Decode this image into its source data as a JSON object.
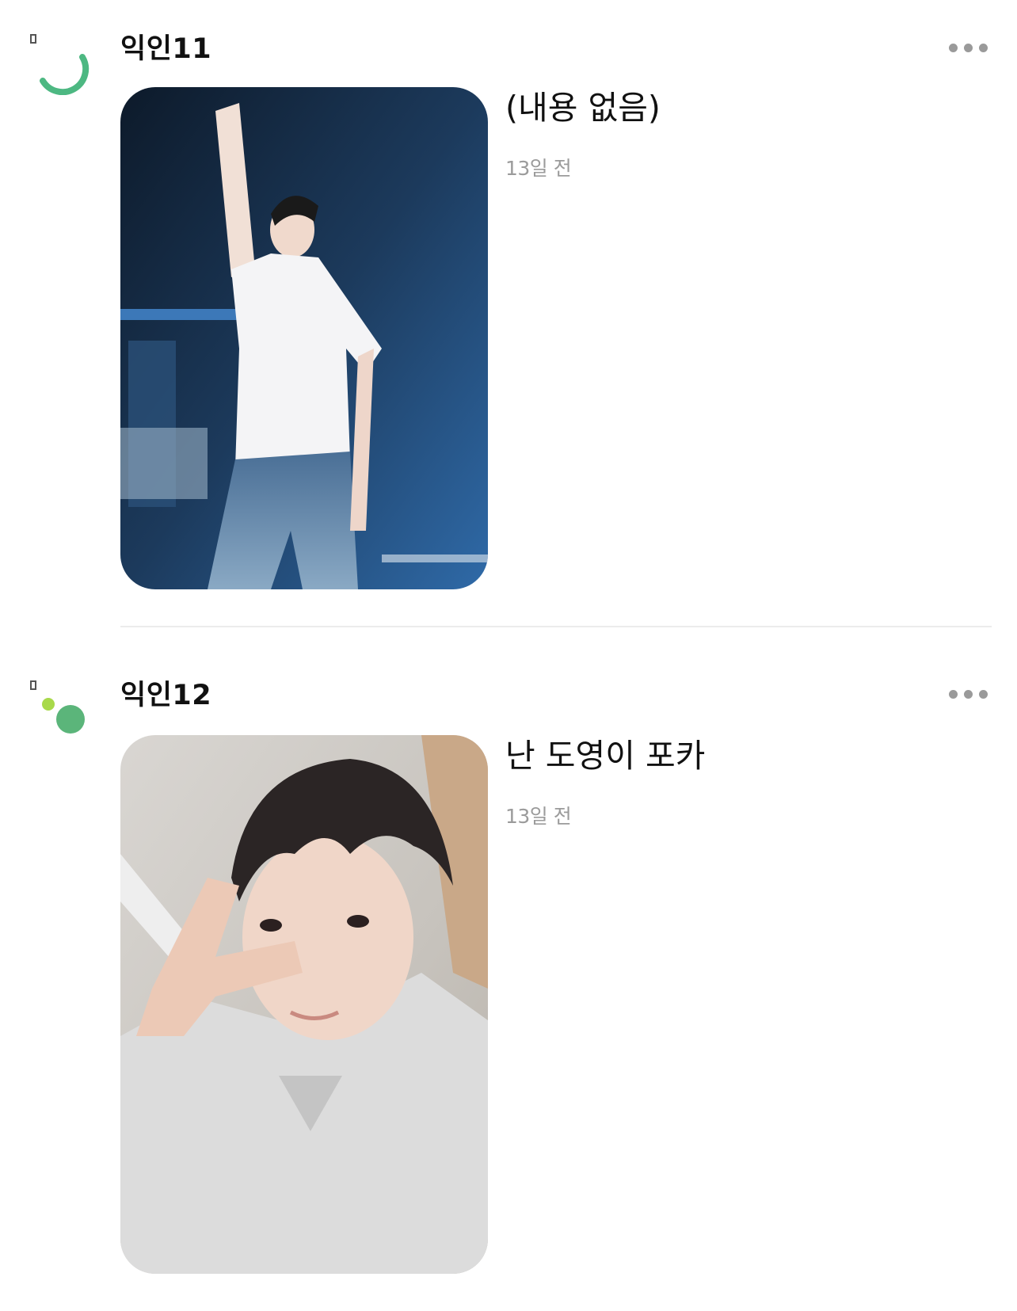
{
  "posts": [
    {
      "author": "익인11",
      "content": "(내용 없음)",
      "time": "13일 전",
      "avatar_icon": "partial-ring-avatar-icon",
      "photo_description_icon": "photo-thumbnail",
      "more_icon": "more-dots-icon"
    },
    {
      "author": "익인12",
      "content": "난 도영이 포카",
      "time": "13일 전",
      "avatar_icon": "dots-avatar-icon",
      "photo_description_icon": "photo-thumbnail",
      "more_icon": "more-dots-icon"
    }
  ],
  "colors": {
    "avatar_green": "#4db882",
    "avatar_lime": "#a8d94a",
    "more_dots": "#9a9a9a",
    "time_text": "#9b9b9b",
    "divider": "#ececec"
  }
}
